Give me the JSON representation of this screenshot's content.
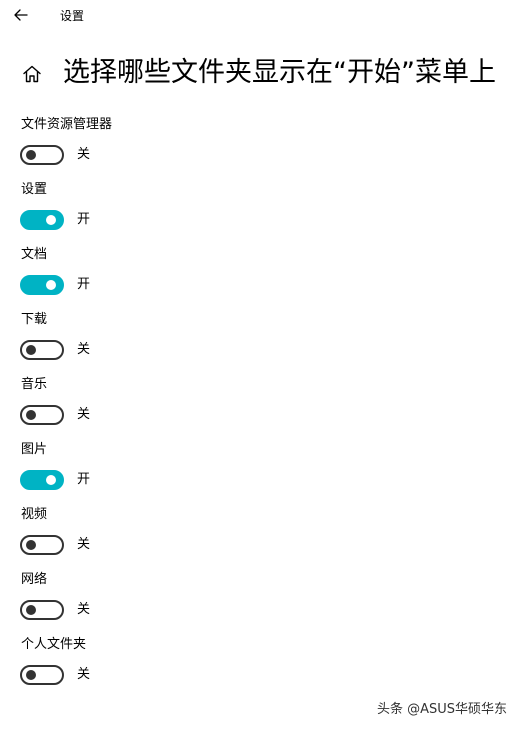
{
  "window": {
    "app_title": "设置",
    "back_icon": "back-arrow-icon"
  },
  "header": {
    "home_icon": "home-icon",
    "page_title": "选择哪些文件夹显示在“开始”菜单上"
  },
  "settings": [
    {
      "label": "文件资源管理器",
      "on": false,
      "state_text": "关"
    },
    {
      "label": "设置",
      "on": true,
      "state_text": "开"
    },
    {
      "label": "文档",
      "on": true,
      "state_text": "开"
    },
    {
      "label": "下载",
      "on": false,
      "state_text": "关"
    },
    {
      "label": "音乐",
      "on": false,
      "state_text": "关"
    },
    {
      "label": "图片",
      "on": true,
      "state_text": "开"
    },
    {
      "label": "视频",
      "on": false,
      "state_text": "关"
    },
    {
      "label": "网络",
      "on": false,
      "state_text": "关"
    },
    {
      "label": "个人文件夹",
      "on": false,
      "state_text": "关"
    }
  ],
  "colors": {
    "toggle_on": "#00b3c4",
    "toggle_off_border": "#333333"
  },
  "watermark": "头条 @ASUS华硕华东"
}
